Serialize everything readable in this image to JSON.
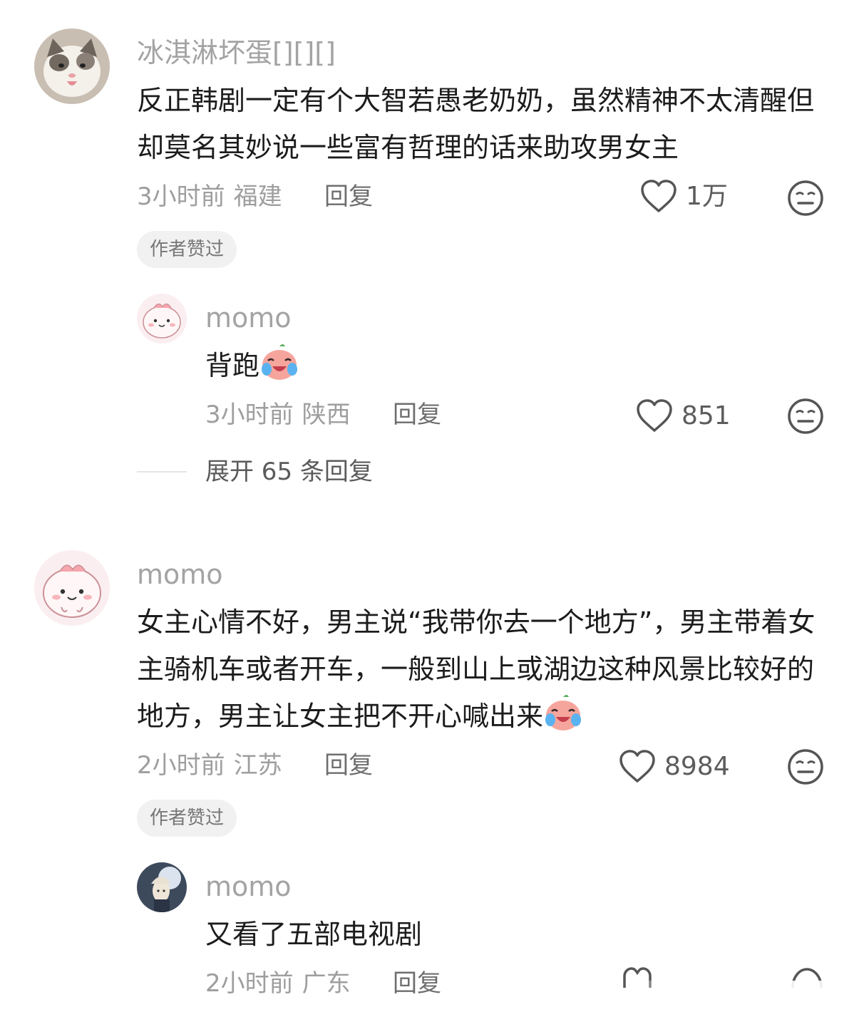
{
  "comments": [
    {
      "username": "冰淇淋坏蛋[][][]",
      "text": "反正韩剧一定有个大智若愚老奶奶，虽然精神不太清醒但却莫名其妙说一些富有哲理的话来助攻男女主",
      "time": "3小时前",
      "region": "福建",
      "reply_label": "回复",
      "likes": "1万",
      "badge": "作者赞过",
      "reply": {
        "username": "momo",
        "text": "背跑",
        "time": "3小时前",
        "region": "陕西",
        "reply_label": "回复",
        "likes": "851"
      },
      "expand_label": "展开 65 条回复"
    },
    {
      "username": "momo",
      "text": "女主心情不好，男主说“我带你去一个地方”，男主带着女主骑机车或者开车，一般到山上或湖边这种风景比较好的地方，男主让女主把不开心喊出来",
      "time": "2小时前",
      "region": "江苏",
      "reply_label": "回复",
      "likes": "8984",
      "badge": "作者赞过",
      "reply": {
        "username": "momo",
        "text": "又看了五部电视剧",
        "time": "2小时前",
        "region": "广东",
        "reply_label": "回复"
      }
    }
  ],
  "icons": {
    "like": "heart-outline-icon",
    "dislike": "meh-face-icon",
    "emoji": "crying-laughing-emoji"
  },
  "colors": {
    "username": "#a3a3a3",
    "meta": "#9e9e9e",
    "badge_bg": "#f1f1f1"
  }
}
